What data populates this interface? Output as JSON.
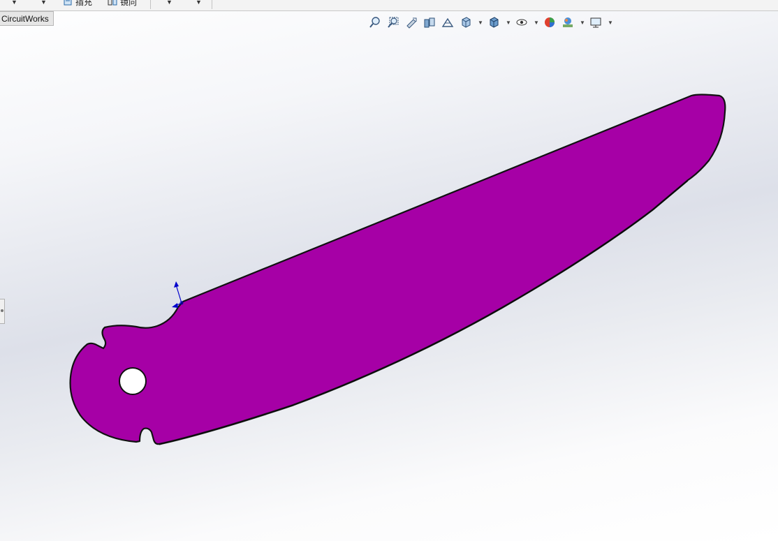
{
  "toolbar": {
    "insert_label": "插充",
    "mirror_label": "镜向"
  },
  "tabs": {
    "circuitworks": "CircuitWorks"
  },
  "heads_up_toolbar": {
    "items": [
      "zoom-to-fit-icon",
      "zoom-to-area-icon",
      "previous-view-icon",
      "section-view-icon",
      "dynamic-annotation-icon",
      "view-orientation-icon",
      "display-style-icon",
      "hide-show-items-icon",
      "edit-appearance-icon",
      "apply-scene-icon",
      "view-settings-icon"
    ]
  },
  "model": {
    "part_color": "#a600a6",
    "edge_color": "#111111",
    "triad_color": "#0000cc"
  }
}
